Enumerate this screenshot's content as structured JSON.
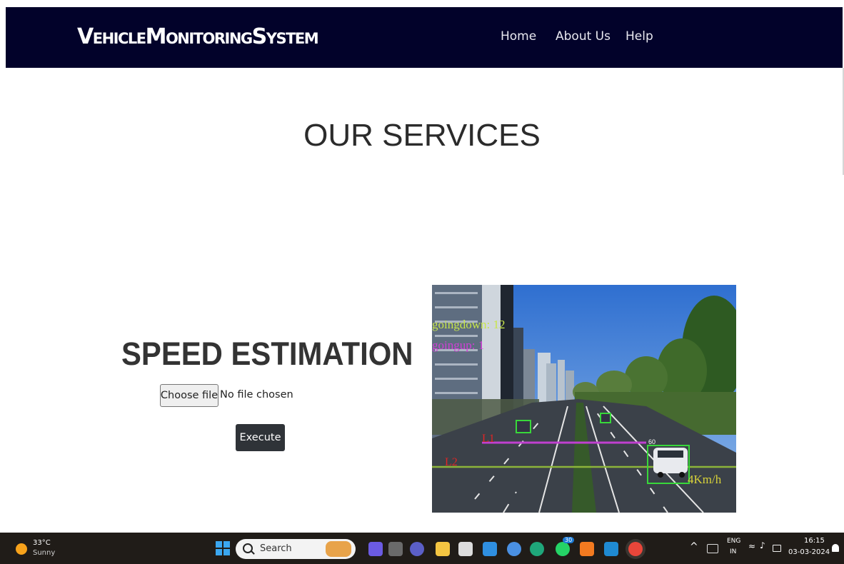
{
  "navbar": {
    "brand": "VehicleMonitoringSystem",
    "links": [
      "Home",
      "About Us",
      "Help"
    ]
  },
  "main": {
    "title": "OUR SERVICES",
    "service": {
      "title": "SPEED ESTIMATION",
      "choose_file_label": "Choose file",
      "file_status": "No file chosen",
      "execute_label": "Execute"
    },
    "preview": {
      "going_down": "goingdown: 12",
      "going_up": "goingup: 1",
      "line1_label": "L1",
      "line2_label": "L2",
      "vehicle_id": "60",
      "speed_label": "4Km/h"
    }
  },
  "taskbar": {
    "weather_temp": "33°C",
    "weather_desc": "Sunny",
    "search_label": "Search",
    "badge_count": "30",
    "lang_line1": "ENG",
    "lang_line2": "IN",
    "time": "16:15",
    "date": "03-03-2024"
  },
  "colors": {
    "navbar_bg": "#02022a",
    "execute_bg": "#2f3338",
    "taskbar_bg": "#201c18",
    "count_down_text": "#c8e64a",
    "count_up_text": "#d13fd6",
    "line_label": "#e02525",
    "detection_box": "#38d83a",
    "speed_text": "#d8d23a"
  },
  "icons": {
    "weather": "sun-icon",
    "start": "windows-start-icon",
    "search": "search-icon",
    "tray_chevron": "chevron-up-icon",
    "wifi": "wifi-icon",
    "volume": "speaker-icon",
    "battery": "battery-icon",
    "notifications": "bell-icon"
  }
}
